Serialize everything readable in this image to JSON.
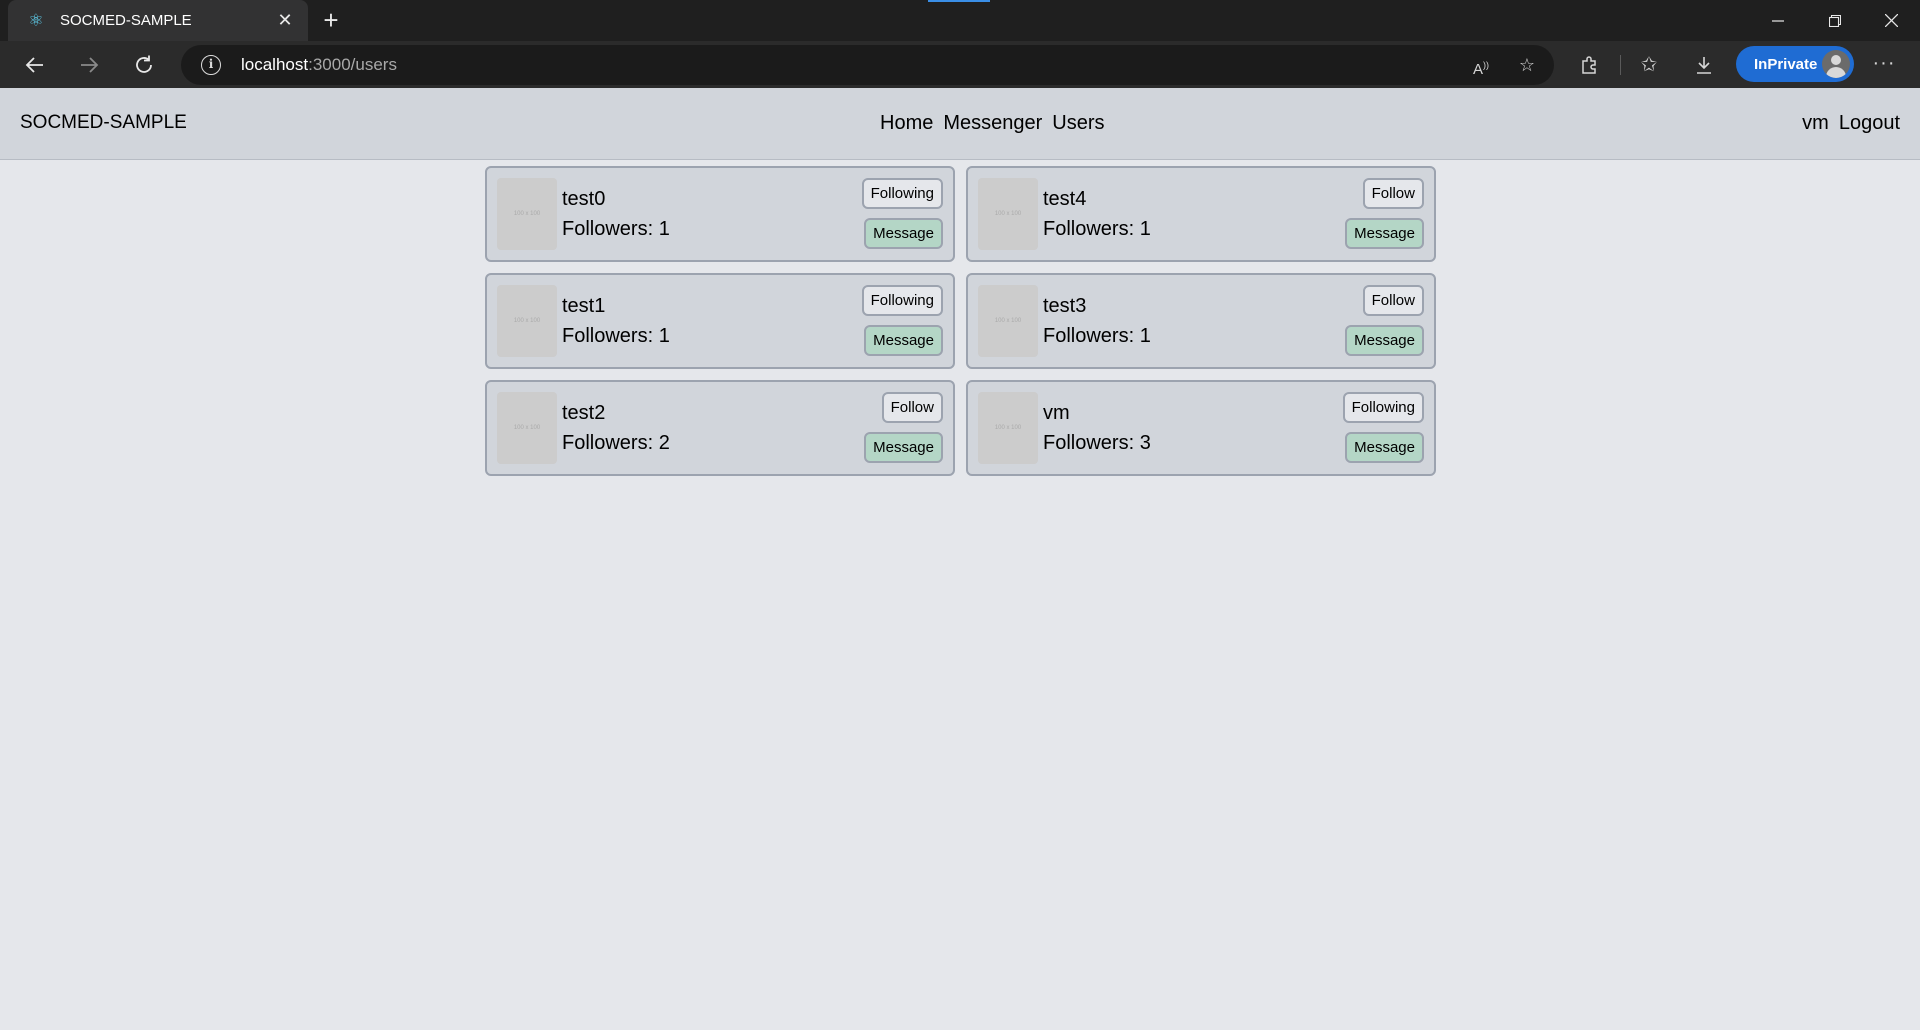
{
  "browser": {
    "tab_title": "SOCMED-SAMPLE",
    "favicon_icon": "react-atom-icon",
    "new_tab_symbol": "+",
    "url_host": "localhost",
    "url_path": ":3000/users",
    "inprivate_label": "InPrivate",
    "inprivate_color": "#1f6cd3"
  },
  "navbar": {
    "brand": "SOCMED-SAMPLE",
    "links": [
      "Home",
      "Messenger",
      "Users"
    ],
    "current_user": "vm",
    "logout_label": "Logout"
  },
  "users": [
    {
      "name": "test0",
      "followers_text": "Followers: 1",
      "follow_label": "Following",
      "message_label": "Message",
      "avatar_placeholder": "100 x 100"
    },
    {
      "name": "test4",
      "followers_text": "Followers: 1",
      "follow_label": "Follow",
      "message_label": "Message",
      "avatar_placeholder": "100 x 100"
    },
    {
      "name": "test1",
      "followers_text": "Followers: 1",
      "follow_label": "Following",
      "message_label": "Message",
      "avatar_placeholder": "100 x 100"
    },
    {
      "name": "test3",
      "followers_text": "Followers: 1",
      "follow_label": "Follow",
      "message_label": "Message",
      "avatar_placeholder": "100 x 100"
    },
    {
      "name": "test2",
      "followers_text": "Followers: 2",
      "follow_label": "Follow",
      "message_label": "Message",
      "avatar_placeholder": "100 x 100"
    },
    {
      "name": "vm",
      "followers_text": "Followers: 3",
      "follow_label": "Following",
      "message_label": "Message",
      "avatar_placeholder": "100 x 100"
    }
  ],
  "colors": {
    "page_bg": "#e5e7eb",
    "navbar_bg": "#d1d5db",
    "card_bg": "#d1d5db",
    "message_button_bg": "#b4d6c6"
  }
}
